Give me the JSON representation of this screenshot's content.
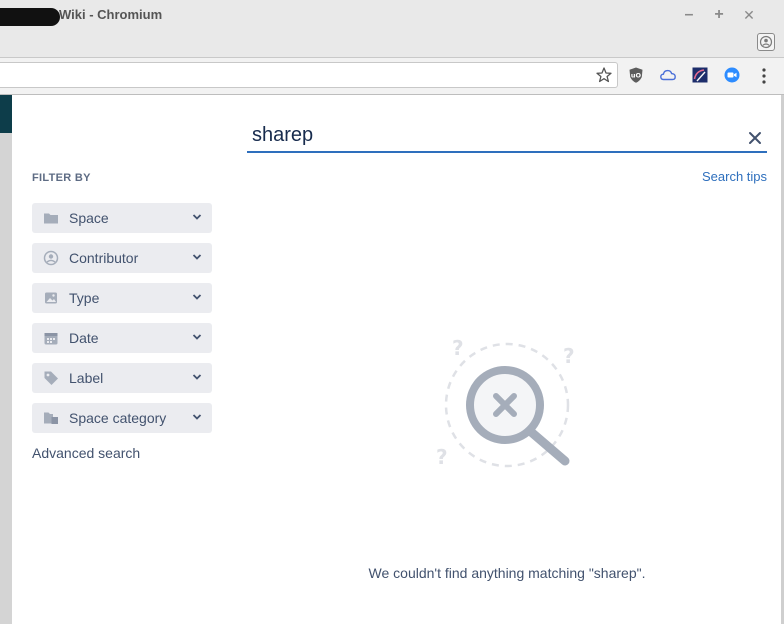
{
  "window": {
    "title": "Wiki - Chromium",
    "minimize_label": "–",
    "maximize_label": "+",
    "close_label": "✕"
  },
  "search": {
    "query": "sharep",
    "tips_label": "Search tips",
    "no_results": "We couldn't find anything matching \"sharep\"."
  },
  "filters": {
    "heading": "FILTER BY",
    "items": [
      {
        "label": "Space",
        "icon": "folder-icon"
      },
      {
        "label": "Contributor",
        "icon": "person-icon"
      },
      {
        "label": "Type",
        "icon": "image-icon"
      },
      {
        "label": "Date",
        "icon": "calendar-icon"
      },
      {
        "label": "Label",
        "icon": "tag-icon"
      },
      {
        "label": "Space category",
        "icon": "folder-category-icon"
      }
    ],
    "advanced_label": "Advanced search"
  },
  "colors": {
    "accent": "#2e6fbd",
    "filter_bg": "#ebecf0",
    "text": "#42526e",
    "icon": "#97a0af"
  }
}
